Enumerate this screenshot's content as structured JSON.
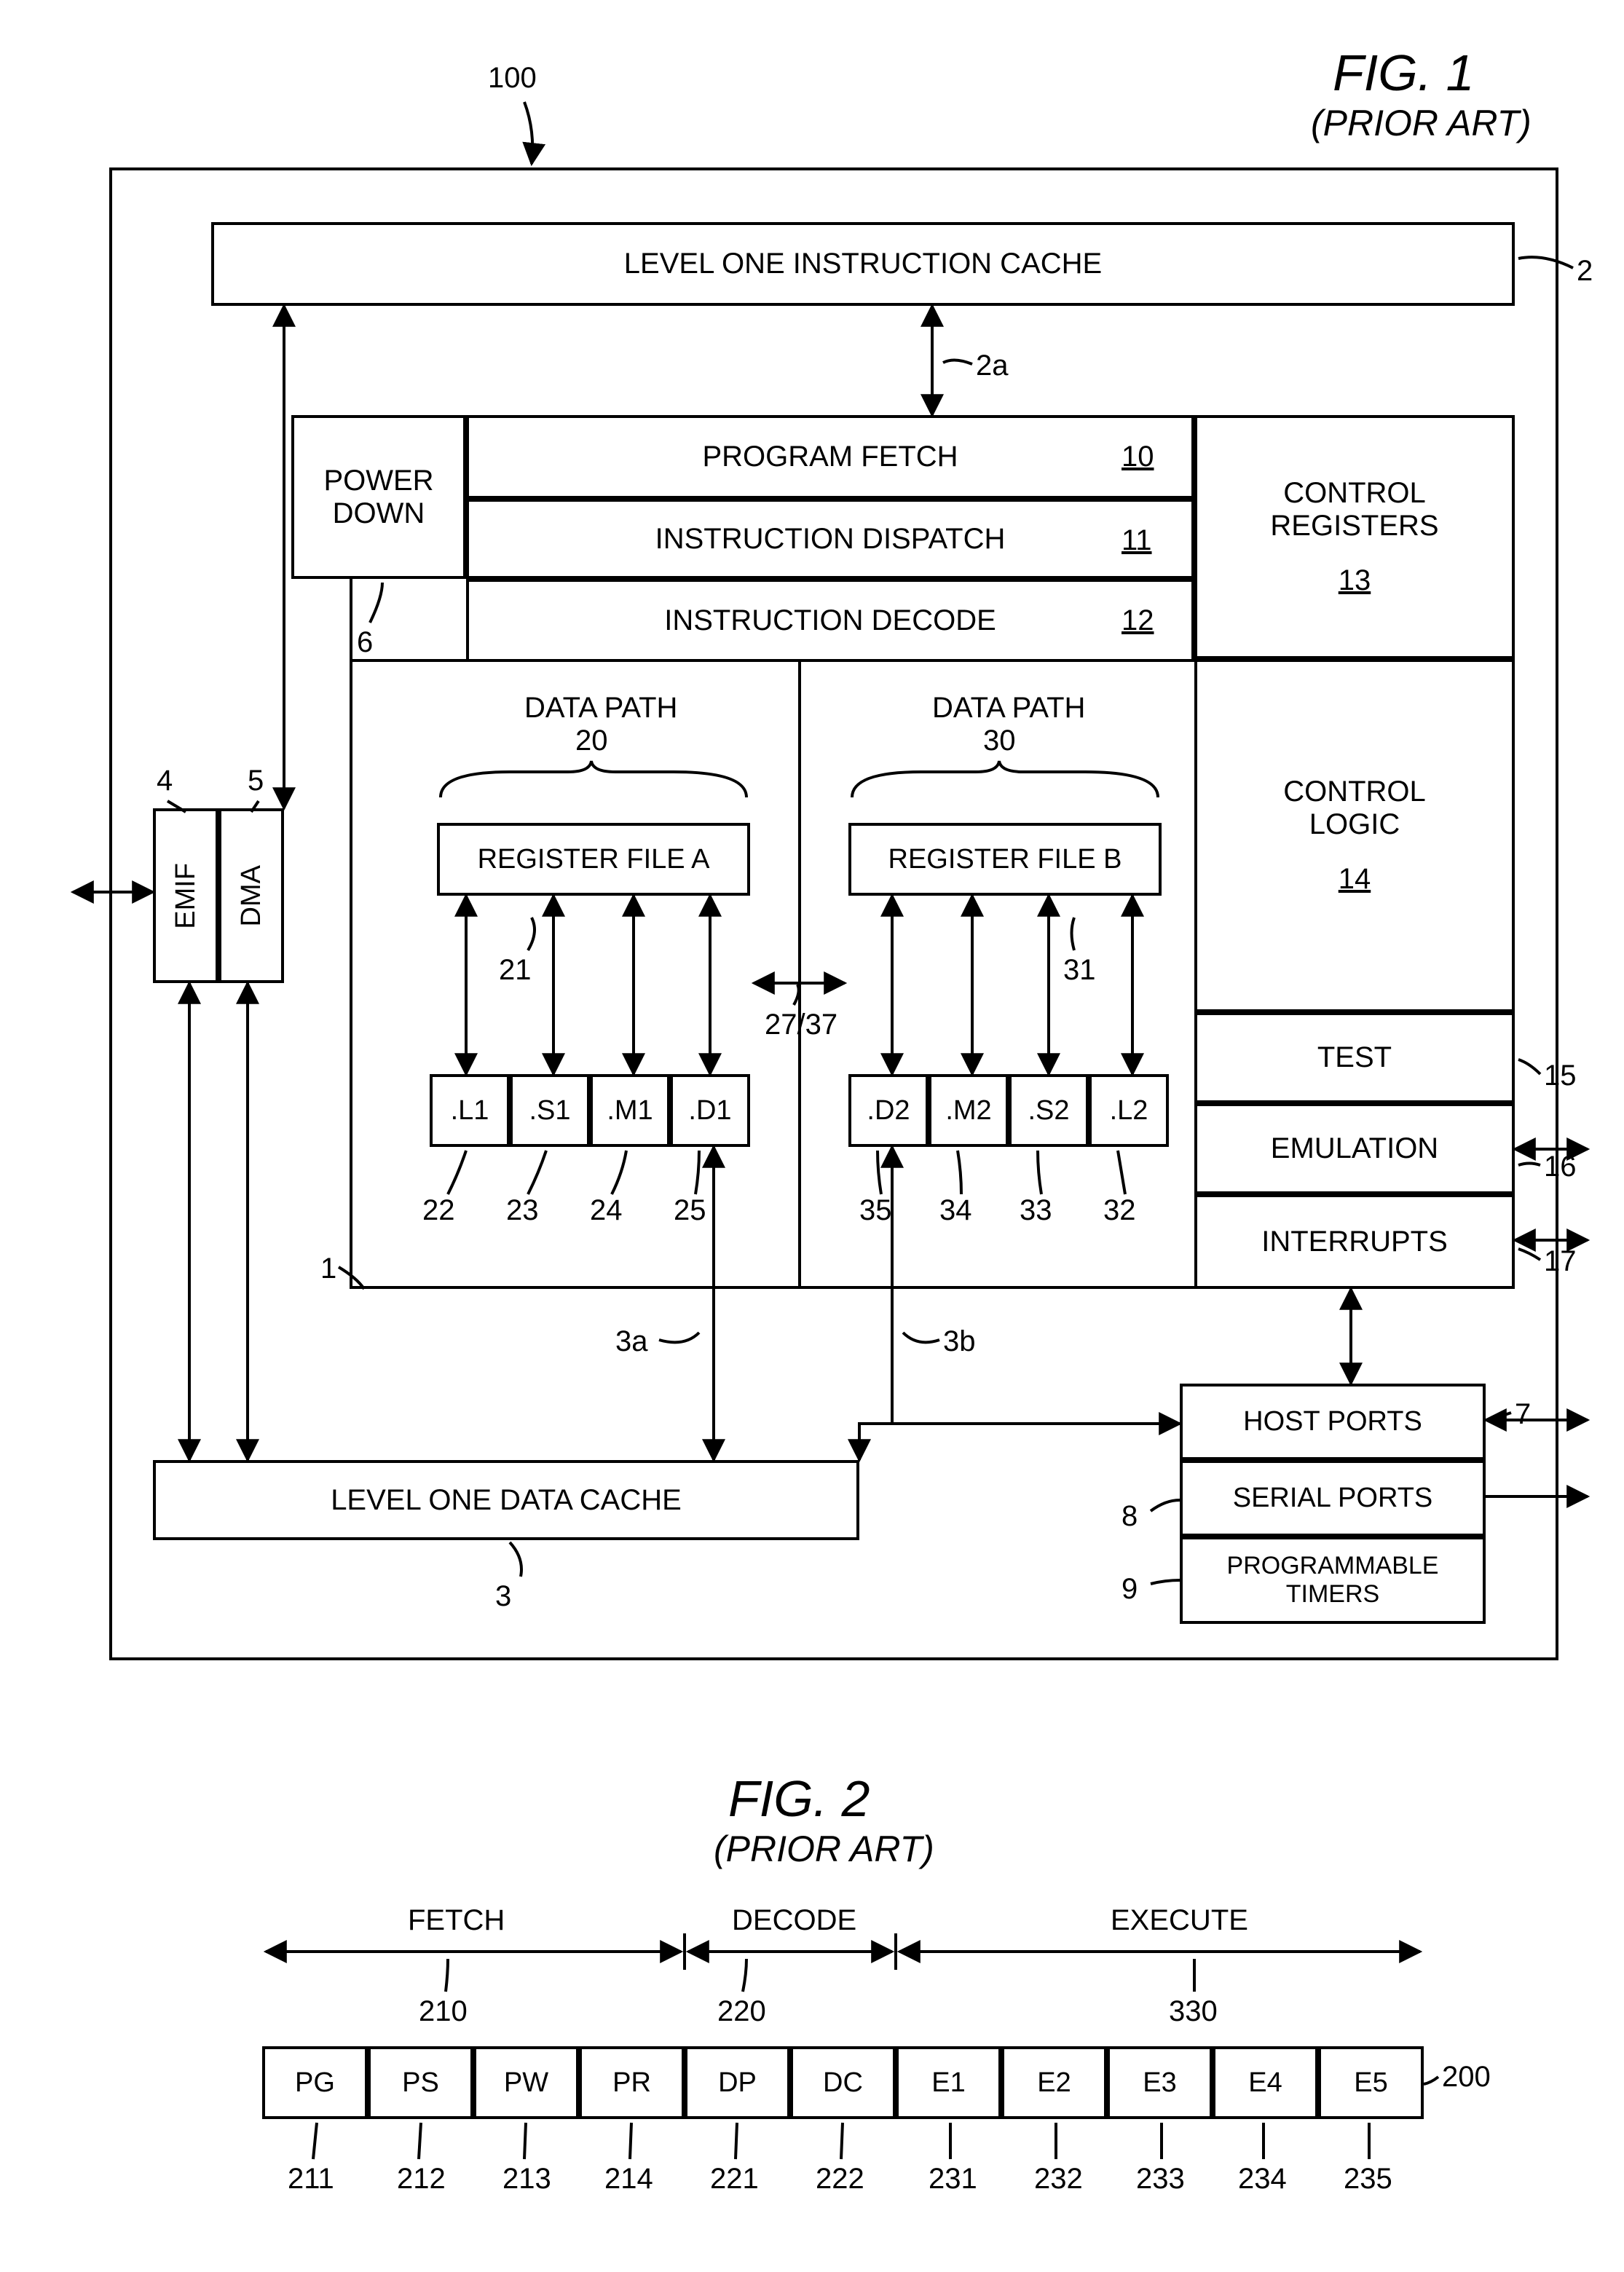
{
  "fig1": {
    "title": "FIG. 1",
    "subtitle": "(PRIOR ART)",
    "ref_100": "100",
    "outer": {},
    "l1i_cache": "LEVEL ONE INSTRUCTION CACHE",
    "l1d_cache": "LEVEL ONE DATA CACHE",
    "ref_2": "2",
    "ref_2a": "2a",
    "ref_3": "3",
    "ref_3a": "3a",
    "ref_3b": "3b",
    "power_down": "POWER\nDOWN",
    "ref_6": "6",
    "emif": "EMIF",
    "dma": "DMA",
    "ref_4": "4",
    "ref_5": "5",
    "ref_1": "1",
    "program_fetch": "PROGRAM FETCH",
    "ref_10": "10",
    "instr_dispatch": "INSTRUCTION DISPATCH",
    "ref_11": "11",
    "instr_decode": "INSTRUCTION DECODE",
    "ref_12": "12",
    "data_path_20_label": "DATA PATH",
    "ref_20": "20",
    "data_path_30_label": "DATA PATH",
    "ref_30": "30",
    "reg_file_a": "REGISTER FILE A",
    "reg_file_b": "REGISTER FILE B",
    "ref_21": "21",
    "ref_31": "31",
    "ref_27_37": "27/37",
    "unit_L1": ".L1",
    "unit_S1": ".S1",
    "unit_M1": ".M1",
    "unit_D1": ".D1",
    "unit_D2": ".D2",
    "unit_M2": ".M2",
    "unit_S2": ".S2",
    "unit_L2": ".L2",
    "ref_22": "22",
    "ref_23": "23",
    "ref_24": "24",
    "ref_25": "25",
    "ref_35": "35",
    "ref_34": "34",
    "ref_33": "33",
    "ref_32": "32",
    "control_registers": "CONTROL\nREGISTERS",
    "ref_13": "13",
    "control_logic": "CONTROL\nLOGIC",
    "ref_14": "14",
    "test": "TEST",
    "ref_15": "15",
    "emulation": "EMULATION",
    "ref_16": "16",
    "interrupts": "INTERRUPTS",
    "ref_17": "17",
    "host_ports": "HOST PORTS",
    "ref_7": "7",
    "serial_ports": "SERIAL PORTS",
    "ref_8": "8",
    "prog_timers": "PROGRAMMABLE\nTIMERS",
    "ref_9": "9"
  },
  "fig2": {
    "title": "FIG. 2",
    "subtitle": "(PRIOR ART)",
    "fetch": "FETCH",
    "decode": "DECODE",
    "execute": "EXECUTE",
    "ref_210": "210",
    "ref_220": "220",
    "ref_330": "330",
    "ref_200": "200",
    "PG": "PG",
    "PS": "PS",
    "PW": "PW",
    "PR": "PR",
    "DP": "DP",
    "DC": "DC",
    "E1": "E1",
    "E2": "E2",
    "E3": "E3",
    "E4": "E4",
    "E5": "E5",
    "ref_211": "211",
    "ref_212": "212",
    "ref_213": "213",
    "ref_214": "214",
    "ref_221": "221",
    "ref_222": "222",
    "ref_231": "231",
    "ref_232": "232",
    "ref_233": "233",
    "ref_234": "234",
    "ref_235": "235"
  }
}
